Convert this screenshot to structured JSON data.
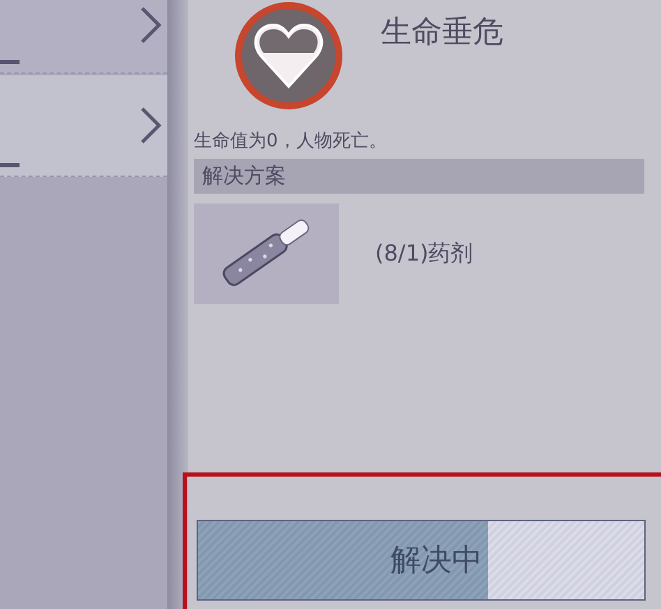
{
  "sidebar": {
    "items": [
      {
        "selected": false
      },
      {
        "selected": true
      }
    ]
  },
  "condition": {
    "title": "生命垂危",
    "description": "生命值为0，人物死亡。"
  },
  "solution": {
    "heading": "解决方案",
    "items": [
      {
        "label": "(8/1)药剂"
      }
    ]
  },
  "progress": {
    "label": "解决中",
    "level": 0.65
  }
}
